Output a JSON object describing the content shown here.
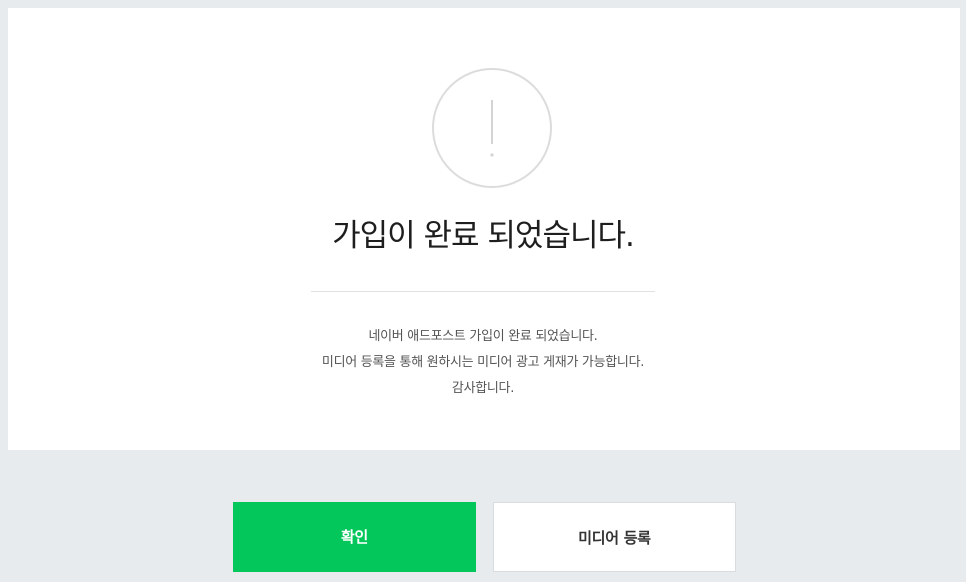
{
  "alert": {
    "icon": "exclamation-icon",
    "title": "가입이 완료 되었습니다.",
    "lines": [
      "네이버 애드포스트 가입이 완료 되었습니다.",
      "미디어 등록을 통해 원하시는 미디어 광고 게재가 가능합니다.",
      "감사합니다."
    ]
  },
  "actions": {
    "confirm_label": "확인",
    "register_media_label": "미디어 등록"
  },
  "colors": {
    "primary_green": "#03c75a",
    "page_background": "#e8ebee",
    "card_background": "#ffffff"
  }
}
